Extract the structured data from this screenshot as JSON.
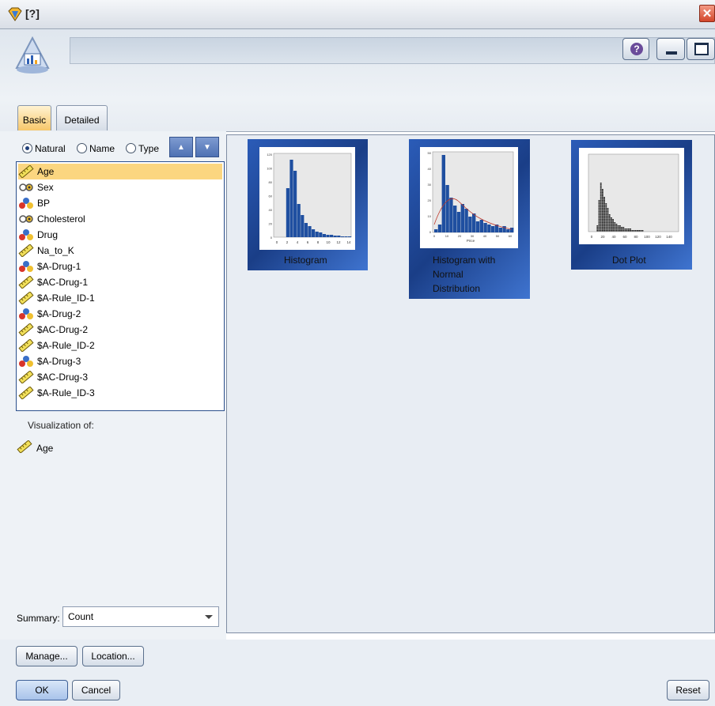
{
  "window": {
    "title": "[?]",
    "close_glyph": "✕"
  },
  "header": {
    "node_name": "",
    "help_glyph": "?"
  },
  "tabs": [
    {
      "label": "Basic",
      "active": true
    },
    {
      "label": "Detailed",
      "active": false
    }
  ],
  "sort": {
    "options": [
      {
        "label": "Natural",
        "checked": true
      },
      {
        "label": "Name",
        "checked": false
      },
      {
        "label": "Type",
        "checked": false
      }
    ]
  },
  "fields": [
    {
      "label": "Age",
      "icon": "continuous-ruler-icon",
      "selected": true
    },
    {
      "label": "Sex",
      "icon": "flag-icon",
      "selected": false
    },
    {
      "label": "BP",
      "icon": "nominal-icon",
      "selected": false
    },
    {
      "label": "Cholesterol",
      "icon": "flag-icon",
      "selected": false
    },
    {
      "label": "Drug",
      "icon": "nominal-icon",
      "selected": false
    },
    {
      "label": "Na_to_K",
      "icon": "continuous-ruler-icon",
      "selected": false
    },
    {
      "label": "$A-Drug-1",
      "icon": "nominal-icon",
      "selected": false
    },
    {
      "label": "$AC-Drug-1",
      "icon": "continuous-ruler-icon",
      "selected": false
    },
    {
      "label": "$A-Rule_ID-1",
      "icon": "continuous-ruler-icon",
      "selected": false
    },
    {
      "label": "$A-Drug-2",
      "icon": "nominal-icon",
      "selected": false
    },
    {
      "label": "$AC-Drug-2",
      "icon": "continuous-ruler-icon",
      "selected": false
    },
    {
      "label": "$A-Rule_ID-2",
      "icon": "continuous-ruler-icon",
      "selected": false
    },
    {
      "label": "$A-Drug-3",
      "icon": "nominal-icon",
      "selected": false
    },
    {
      "label": "$AC-Drug-3",
      "icon": "continuous-ruler-icon",
      "selected": false
    },
    {
      "label": "$A-Rule_ID-3",
      "icon": "continuous-ruler-icon",
      "selected": false
    }
  ],
  "visualization": {
    "label": "Visualization of:",
    "item": "Age"
  },
  "summary": {
    "label": "Summary:",
    "value": "Count"
  },
  "gallery": [
    {
      "caption": "Histogram"
    },
    {
      "caption": "Histogram with Normal Distribution"
    },
    {
      "caption": "Dot Plot"
    }
  ],
  "thumb_labels": {
    "hist_y": [
      "120",
      "100",
      "80",
      "60",
      "40",
      "20",
      "0"
    ],
    "hist_x": [
      "0",
      "2",
      "4",
      "6",
      "8",
      "10",
      "12",
      "14"
    ],
    "normal_y": [
      "50",
      "40",
      "30",
      "20",
      "10",
      "0"
    ],
    "normal_x": [
      "0",
      "10",
      "20",
      "30",
      "40",
      "50",
      "60"
    ],
    "normal_xlabel": "Price",
    "dot_x": [
      "0",
      "20",
      "40",
      "60",
      "80",
      "100",
      "120",
      "140"
    ]
  },
  "buttons": {
    "manage": "Manage...",
    "location": "Location...",
    "ok": "OK",
    "cancel": "Cancel",
    "reset": "Reset"
  },
  "colors": {
    "accent": "#2b5cb8",
    "selected_row": "#fbd680",
    "active_tab": "#f7c76a"
  }
}
